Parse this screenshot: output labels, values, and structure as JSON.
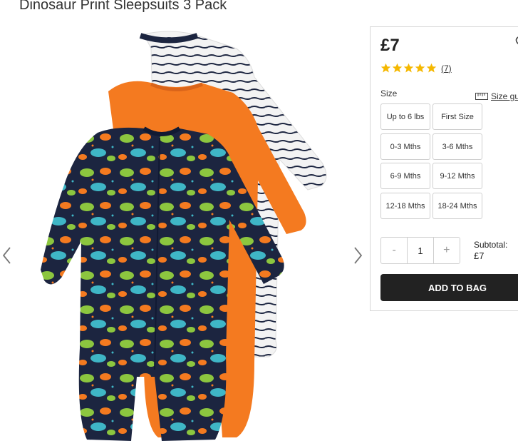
{
  "product": {
    "title": "Dinosaur Print Sleepsuits 3 Pack",
    "price": "£7",
    "rating": {
      "stars": 5,
      "max": 5,
      "count_label": "(7)"
    }
  },
  "size": {
    "label": "Size",
    "guide_label": "Size guide",
    "options": [
      "Up to 6 lbs",
      "First Size",
      "0-3 Mths",
      "3-6 Mths",
      "6-9 Mths",
      "9-12 Mths",
      "12-18 Mths",
      "18-24 Mths"
    ]
  },
  "quantity": {
    "minus": "-",
    "value": "1",
    "plus": "+"
  },
  "subtotal": {
    "label": "Subtotal:",
    "amount": "£7"
  },
  "add_to_bag_label": "ADD TO BAG",
  "colors": {
    "accent": "#f5b800",
    "button": "#222222",
    "orange": "#f47a20",
    "navy": "#1c2540"
  },
  "icons": {
    "prev": "chevron-left-icon",
    "next": "chevron-right-icon",
    "wishlist": "heart-icon",
    "size_guide": "ruler-icon",
    "star": "star-icon"
  }
}
